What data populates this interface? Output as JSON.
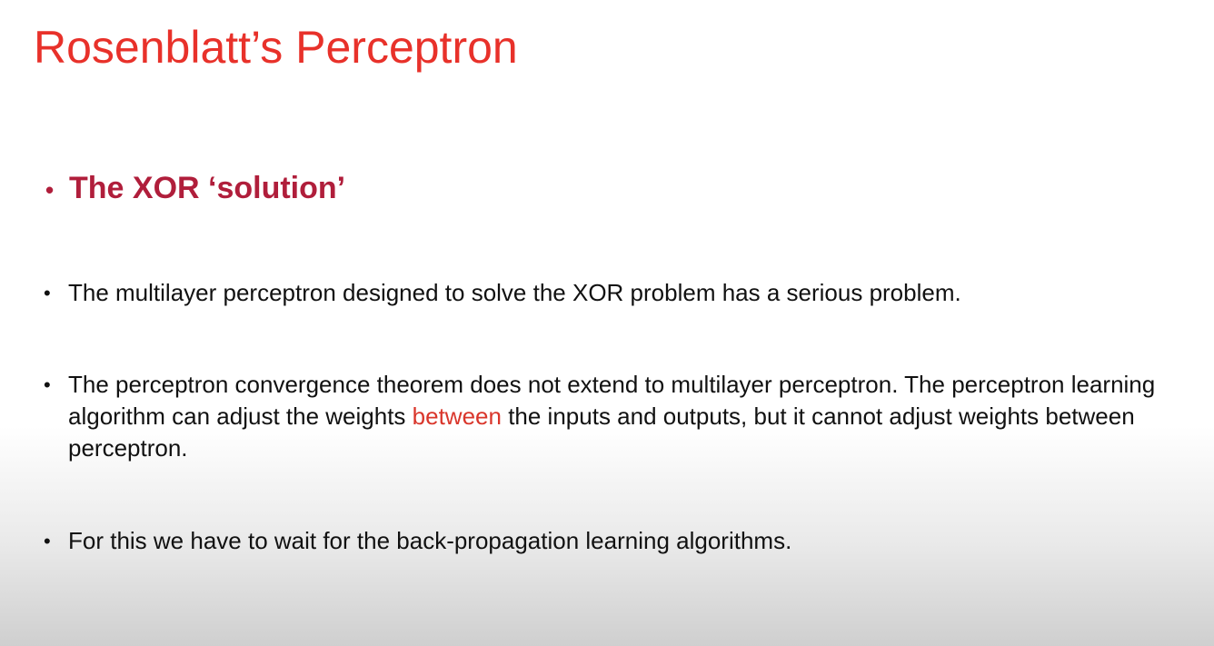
{
  "colors": {
    "title": "#e8312a",
    "section_heading": "#b01e3b",
    "highlight": "#d9362b",
    "body_text": "#111111"
  },
  "slide": {
    "title": "Rosenblatt’s Perceptron",
    "section_bullet": "•",
    "section_heading": "The XOR ‘solution’",
    "bullet_glyph": "•",
    "bullets": [
      {
        "text": "The multilayer perceptron designed to solve the XOR problem has a serious problem."
      },
      {
        "text_before": "The perceptron convergence theorem does not extend to multilayer perceptron.  The perceptron learning algorithm can adjust the weights ",
        "highlight": "between",
        "text_after": " the inputs and outputs, but it cannot adjust weights between perceptron."
      },
      {
        "text": "For this we have to wait for the back-propagation learning algorithms."
      }
    ]
  }
}
